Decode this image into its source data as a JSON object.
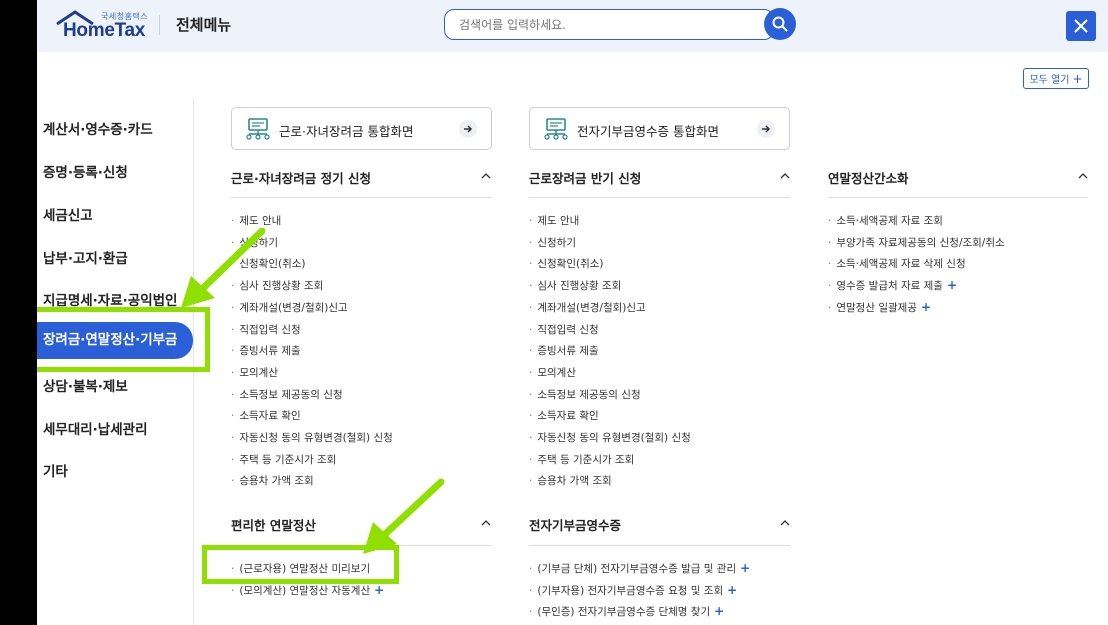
{
  "header": {
    "logo_small": "국세청홈택스",
    "logo_main": "HomeTax",
    "title": "전체메뉴",
    "search_placeholder": "검색어를 입력하세요."
  },
  "expand_all_label": "모두 열기",
  "sidebar": {
    "items": [
      {
        "label": "계산서·영수증·카드"
      },
      {
        "label": "증명·등록·신청"
      },
      {
        "label": "세금신고"
      },
      {
        "label": "납부·고지·환급"
      },
      {
        "label": "지급명세·자료·공익법인"
      },
      {
        "label": "장려금·연말정산·기부금",
        "active": true
      },
      {
        "label": "상담·불복·제보"
      },
      {
        "label": "세무대리·납세관리"
      },
      {
        "label": "기타"
      }
    ]
  },
  "quick_buttons": [
    {
      "label": "근로·자녀장려금 통합화면"
    },
    {
      "label": "전자기부금영수증 통합화면"
    }
  ],
  "sections": {
    "col1_a": {
      "title": "근로·자녀장려금 정기 신청",
      "items": [
        "제도 안내",
        "신청하기",
        "신청확인(취소)",
        "심사 진행상황 조회",
        "계좌개설(변경/철회)신고",
        "직접입력 신청",
        "증빙서류 제출",
        "모의계산",
        "소득정보 제공동의 신청",
        "소득자료 확인",
        "자동신청 동의 유형변경(철회) 신청",
        "주택 등 기준시가 조회",
        "승용차 가액 조회"
      ]
    },
    "col2_a": {
      "title": "근로장려금 반기 신청",
      "items": [
        "제도 안내",
        "신청하기",
        "신청확인(취소)",
        "심사 진행상황 조회",
        "계좌개설(변경/철회)신고",
        "직접입력 신청",
        "증빙서류 제출",
        "모의계산",
        "소득정보 제공동의 신청",
        "소득자료 확인",
        "자동신청 동의 유형변경(철회) 신청",
        "주택 등 기준시가 조회",
        "승용차 가액 조회"
      ]
    },
    "col3_a": {
      "title": "연말정산간소화",
      "items": [
        "소득·세액공제 자료 조회",
        "부양가족 자료제공동의 신청/조회/취소",
        "소득·세액공제 자료 삭제 신청",
        "영수증 발급처 자료 제출",
        "연말정산 일괄제공"
      ],
      "plus": [
        false,
        false,
        false,
        true,
        true
      ]
    },
    "col1_b": {
      "title": "편리한 연말정산",
      "items": [
        "(근로자용) 연말정산 미리보기",
        "(모의계산) 연말정산 자동계산"
      ],
      "plus": [
        false,
        true
      ]
    },
    "col2_b": {
      "title": "전자기부금영수증",
      "items": [
        "(기부금 단체) 전자기부금영수증 발급 및 관리",
        "(기부자용) 전자기부금영수증 요청 및 조회",
        "(무인증) 전자기부금영수증 단체명 찾기"
      ],
      "plus": [
        true,
        true,
        true
      ]
    }
  },
  "colors": {
    "accent": "#2b5fd8",
    "highlight": "#8fe000",
    "header_bg": "#eef2fb"
  }
}
